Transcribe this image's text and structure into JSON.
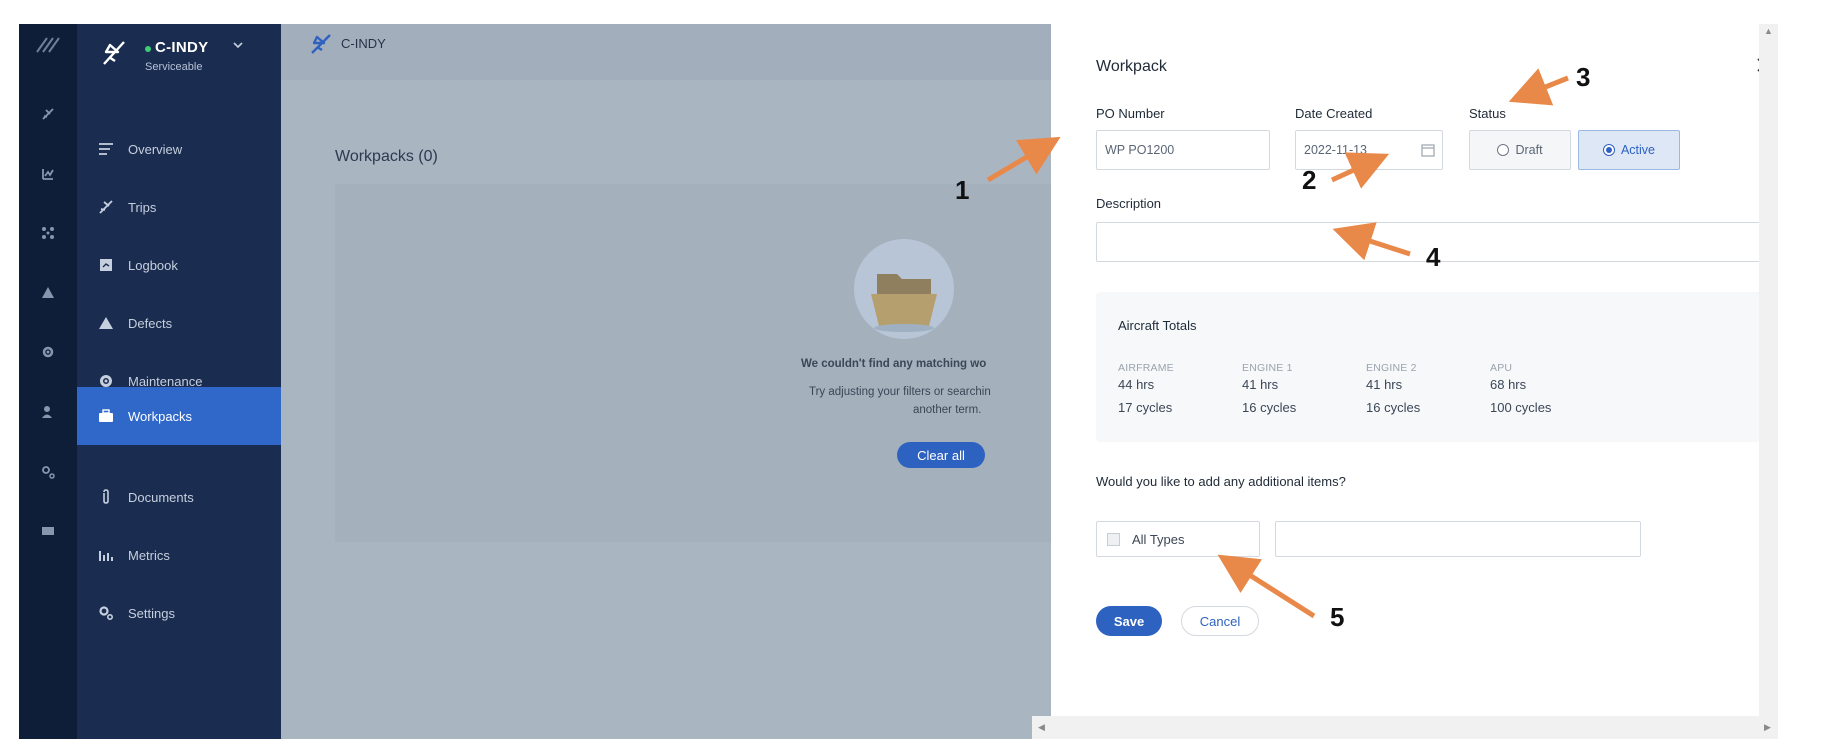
{
  "aircraft": {
    "name": "C-INDY",
    "status": "Serviceable"
  },
  "topbar": {
    "aircraft_name": "C-INDY"
  },
  "nav": [
    {
      "label": "Overview",
      "icon": "list-icon"
    },
    {
      "label": "Trips",
      "icon": "plane-icon"
    },
    {
      "label": "Logbook",
      "icon": "book-icon"
    },
    {
      "label": "Defects",
      "icon": "warning-icon"
    },
    {
      "label": "Maintenance",
      "icon": "gear-icon"
    },
    {
      "label": "Workpacks",
      "icon": "briefcase-icon",
      "active": true
    },
    {
      "label": "Documents",
      "icon": "paperclip-icon"
    },
    {
      "label": "Metrics",
      "icon": "bar-chart-icon"
    },
    {
      "label": "Settings",
      "icon": "settings-icon"
    }
  ],
  "main": {
    "title": "Workpacks (0)",
    "empty_title": "We couldn't find any matching wo",
    "empty_sub_line1": "Try adjusting your filters or searchin",
    "empty_sub_line2": "another term.",
    "clear_label": "Clear all"
  },
  "drawer": {
    "title": "Workpack",
    "po_label": "PO Number",
    "po_value": "WP PO1200",
    "date_label": "Date Created",
    "date_value": "2022-11-13",
    "status_label": "Status",
    "status_options": [
      "Draft",
      "Active"
    ],
    "status_selected": "Active",
    "description_label": "Description",
    "description_value": "",
    "totals": {
      "title": "Aircraft Totals",
      "columns": [
        {
          "head": "AIRFRAME",
          "hours": "44 hrs",
          "cycles": "17 cycles"
        },
        {
          "head": "ENGINE 1",
          "hours": "41 hrs",
          "cycles": "16 cycles"
        },
        {
          "head": "ENGINE 2",
          "hours": "41 hrs",
          "cycles": "16 cycles"
        },
        {
          "head": "APU",
          "hours": "68 hrs",
          "cycles": "100 cycles"
        }
      ]
    },
    "additional_question": "Would you like to add any additional items?",
    "type_select_label": "All Types",
    "save_label": "Save",
    "cancel_label": "Cancel"
  },
  "callouts": [
    "1",
    "2",
    "3",
    "4",
    "5"
  ],
  "colors": {
    "accent": "#2e62c0",
    "sidebar": "#1a2c4f",
    "rail": "#0f1e38",
    "arrow": "#e8894a"
  }
}
